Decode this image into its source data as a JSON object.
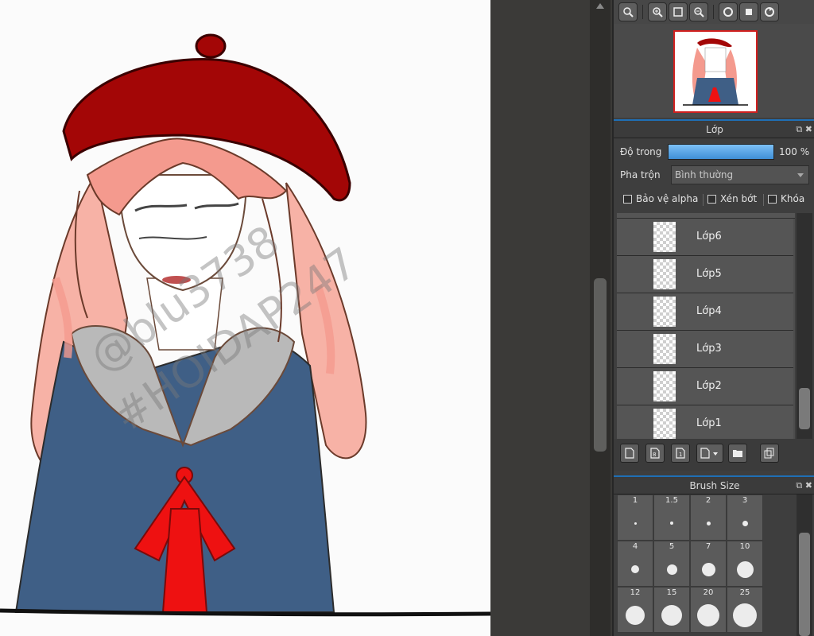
{
  "navigator": {
    "tools": [
      "zoom-fit-icon",
      "zoom-in-icon",
      "fit-window-icon",
      "zoom-out-icon",
      "rotate-icon",
      "fullscreen-icon",
      "reset-rotate-icon"
    ]
  },
  "layer_panel": {
    "title": "Lớp",
    "opacity_label": "Độ trong",
    "opacity_value": "100 %",
    "opacity_fraction": 1.0,
    "blend_label": "Pha trộn",
    "blend_value": "Bình thường",
    "checkboxes": [
      "Bảo vệ alpha",
      "Xén bớt",
      "Khóa"
    ],
    "layers": [
      {
        "name": "Lớp6"
      },
      {
        "name": "Lớp5"
      },
      {
        "name": "Lớp4"
      },
      {
        "name": "Lớp3"
      },
      {
        "name": "Lớp2"
      },
      {
        "name": "Lớp1"
      }
    ]
  },
  "brush_panel": {
    "title": "Brush Size",
    "sizes": [
      "1",
      "1.5",
      "2",
      "3",
      "4",
      "5",
      "7",
      "10",
      "12",
      "15",
      "20",
      "25"
    ]
  },
  "canvas": {
    "watermark_lines": [
      "@blu3738",
      "#HOIDAP247"
    ],
    "colors": {
      "hat": "#a30606",
      "hair": "#f49a8e",
      "dress": "#3f5f86",
      "bow": "#ee1111",
      "collar": "#b9b9b9"
    }
  }
}
